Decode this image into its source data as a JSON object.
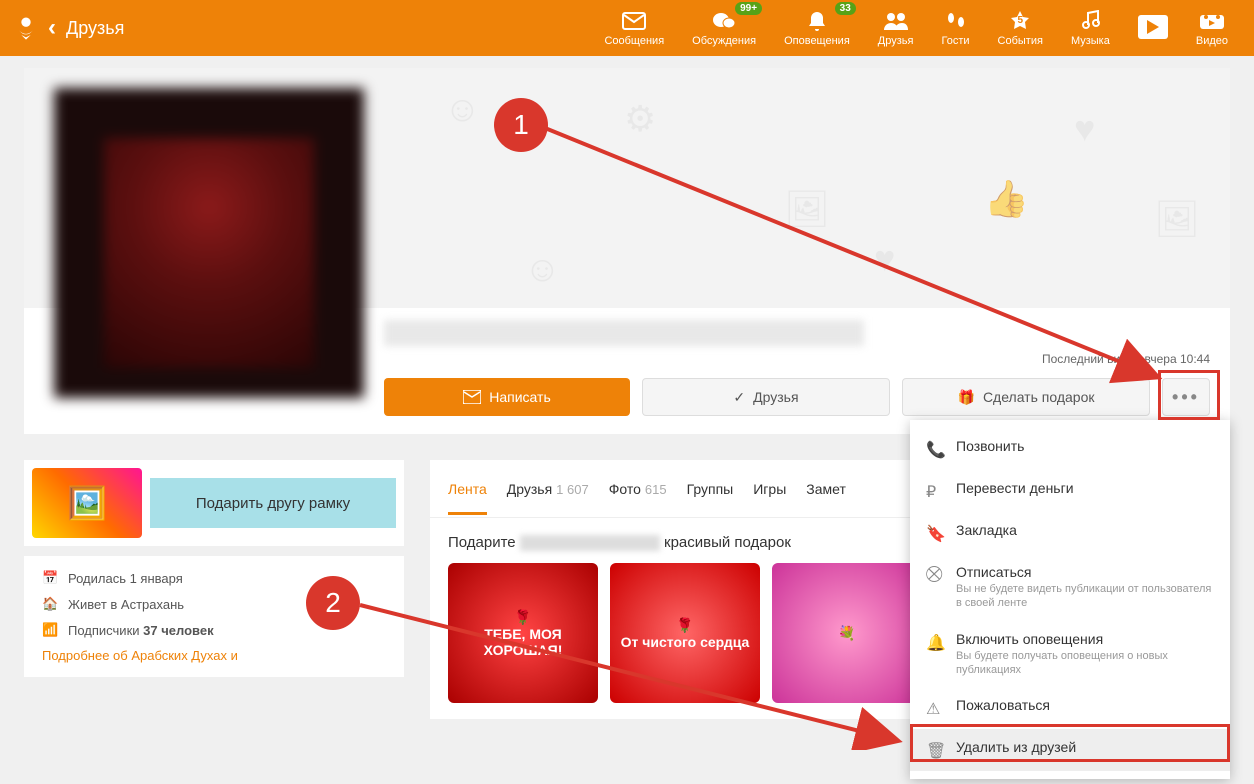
{
  "header": {
    "page_title": "Друзья",
    "nav": [
      {
        "label": "Сообщения",
        "icon": "envelope"
      },
      {
        "label": "Обсуждения",
        "icon": "chat",
        "badge": "99+"
      },
      {
        "label": "Оповещения",
        "icon": "bell",
        "badge": "33"
      },
      {
        "label": "Друзья",
        "icon": "people"
      },
      {
        "label": "Гости",
        "icon": "footsteps"
      },
      {
        "label": "События",
        "icon": "star",
        "badge_dot": "5"
      },
      {
        "label": "Музыка",
        "icon": "music"
      },
      {
        "label": "",
        "icon": "play"
      },
      {
        "label": "Видео",
        "icon": "video"
      }
    ]
  },
  "profile": {
    "last_visit": "Последний визит: вчера 10:44",
    "actions": {
      "write": "Написать",
      "friends": "Друзья",
      "gift": "Сделать подарок"
    }
  },
  "dropdown": {
    "items": [
      {
        "label": "Позвонить",
        "icon": "phone"
      },
      {
        "label": "Перевести деньги",
        "icon": "ruble"
      },
      {
        "label": "Закладка",
        "icon": "bookmark"
      },
      {
        "label": "Отписаться",
        "icon": "unsub",
        "sub": "Вы не будете видеть публикации от пользователя в своей ленте"
      },
      {
        "label": "Включить оповещения",
        "icon": "bell",
        "sub": "Вы будете получать оповещения о новых публикациях"
      },
      {
        "label": "Пожаловаться",
        "icon": "alert"
      },
      {
        "label": "Удалить из друзей",
        "icon": "trash"
      }
    ]
  },
  "sidebar": {
    "gift_banner": "Подарить другу рамку",
    "info": {
      "born": "Родилась 1 января",
      "lives": "Живет в Астрахань",
      "subs_label": "Подписчики",
      "subs_count": "37 человек",
      "more": "Подробнее об Арабских Духах и"
    }
  },
  "tabs": [
    {
      "label": "Лента",
      "active": true
    },
    {
      "label": "Друзья",
      "count": "1 607"
    },
    {
      "label": "Фото",
      "count": "615"
    },
    {
      "label": "Группы"
    },
    {
      "label": "Игры"
    },
    {
      "label": "Замет"
    }
  ],
  "gift_block": {
    "title_before": "Подарите",
    "title_after": "красивый подарок",
    "cards": [
      "ТЕБЕ, МОЯ ХОРОШАЯ!",
      "От чистого сердца",
      ""
    ]
  },
  "annotations": {
    "c1": "1",
    "c2": "2"
  }
}
